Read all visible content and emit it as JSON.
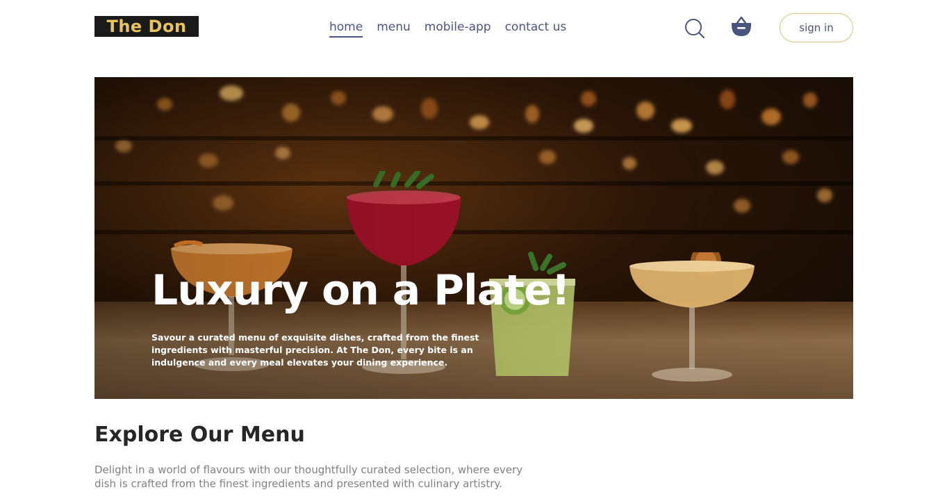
{
  "header": {
    "logo_text": "The Don",
    "nav": [
      {
        "label": "home",
        "active": true
      },
      {
        "label": "menu",
        "active": false
      },
      {
        "label": "mobile-app",
        "active": false
      },
      {
        "label": "contact us",
        "active": false
      }
    ],
    "search_icon": "search-icon",
    "basket_icon": "basket-icon",
    "signin_label": "sign in"
  },
  "hero": {
    "title": "Luxury on a Plate!",
    "text": "Savour a curated menu of exquisite dishes, crafted from the finest ingredients with masterful precision. At The Don, every bite is an indulgence and every meal elevates your dining experience."
  },
  "explore": {
    "title": "Explore Our Menu",
    "text": "Delight in a world of flavours with our thoughtfully curated selection, where every dish is crafted from the finest ingredients and presented with culinary artistry."
  },
  "colors": {
    "text_primary": "#49557e",
    "logo_bg": "#1a1a1a",
    "logo_text": "#e8c45c",
    "signin_border": "#d8c47e",
    "heading": "#262626",
    "muted": "#808080"
  }
}
